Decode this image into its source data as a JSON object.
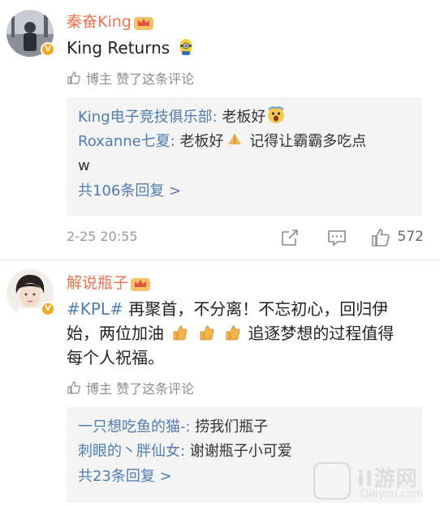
{
  "comments": [
    {
      "username": "秦奋King",
      "text": "King Returns",
      "liked_label": "博主 赞了这条评论",
      "replies": [
        {
          "user": "King电子竞技俱乐部:",
          "text": " 老板好"
        },
        {
          "user": "Roxanne七夏:",
          "text": " 老板好",
          "text2": " 记得让霸霸多吃点"
        },
        {
          "text": "w"
        }
      ],
      "more_replies": "共106条回复 >",
      "time": "2-25 20:55",
      "likes": "572"
    },
    {
      "username": "解说瓶子",
      "topic": "#KPL#",
      "text_part1": " 再聚首，不分离！不忘初心，回归伊",
      "text_part2": "始，两位加油",
      "text_part3": " 追逐梦想的过程值得",
      "text_part4": "每个人祝福。",
      "liked_label": "博主 赞了这条评论",
      "replies": [
        {
          "user": "一只想吃鱼的猫-:",
          "text": " 捞我们瓶子"
        },
        {
          "user": "刺眼的丶胖仙女:",
          "text": " 谢谢瓶子小可爱"
        }
      ],
      "more_replies": "共23条回复 >"
    }
  ],
  "watermark": {
    "name": "iI游网",
    "url": "Qieyou.com"
  },
  "colors": {
    "username": "#eb7350",
    "link": "#507daf",
    "reply_bg": "#f4f4f4"
  },
  "icons": [
    "verified-badge",
    "crown-icon",
    "thumb-up-icon",
    "share-icon",
    "comment-icon",
    "like-icon"
  ]
}
